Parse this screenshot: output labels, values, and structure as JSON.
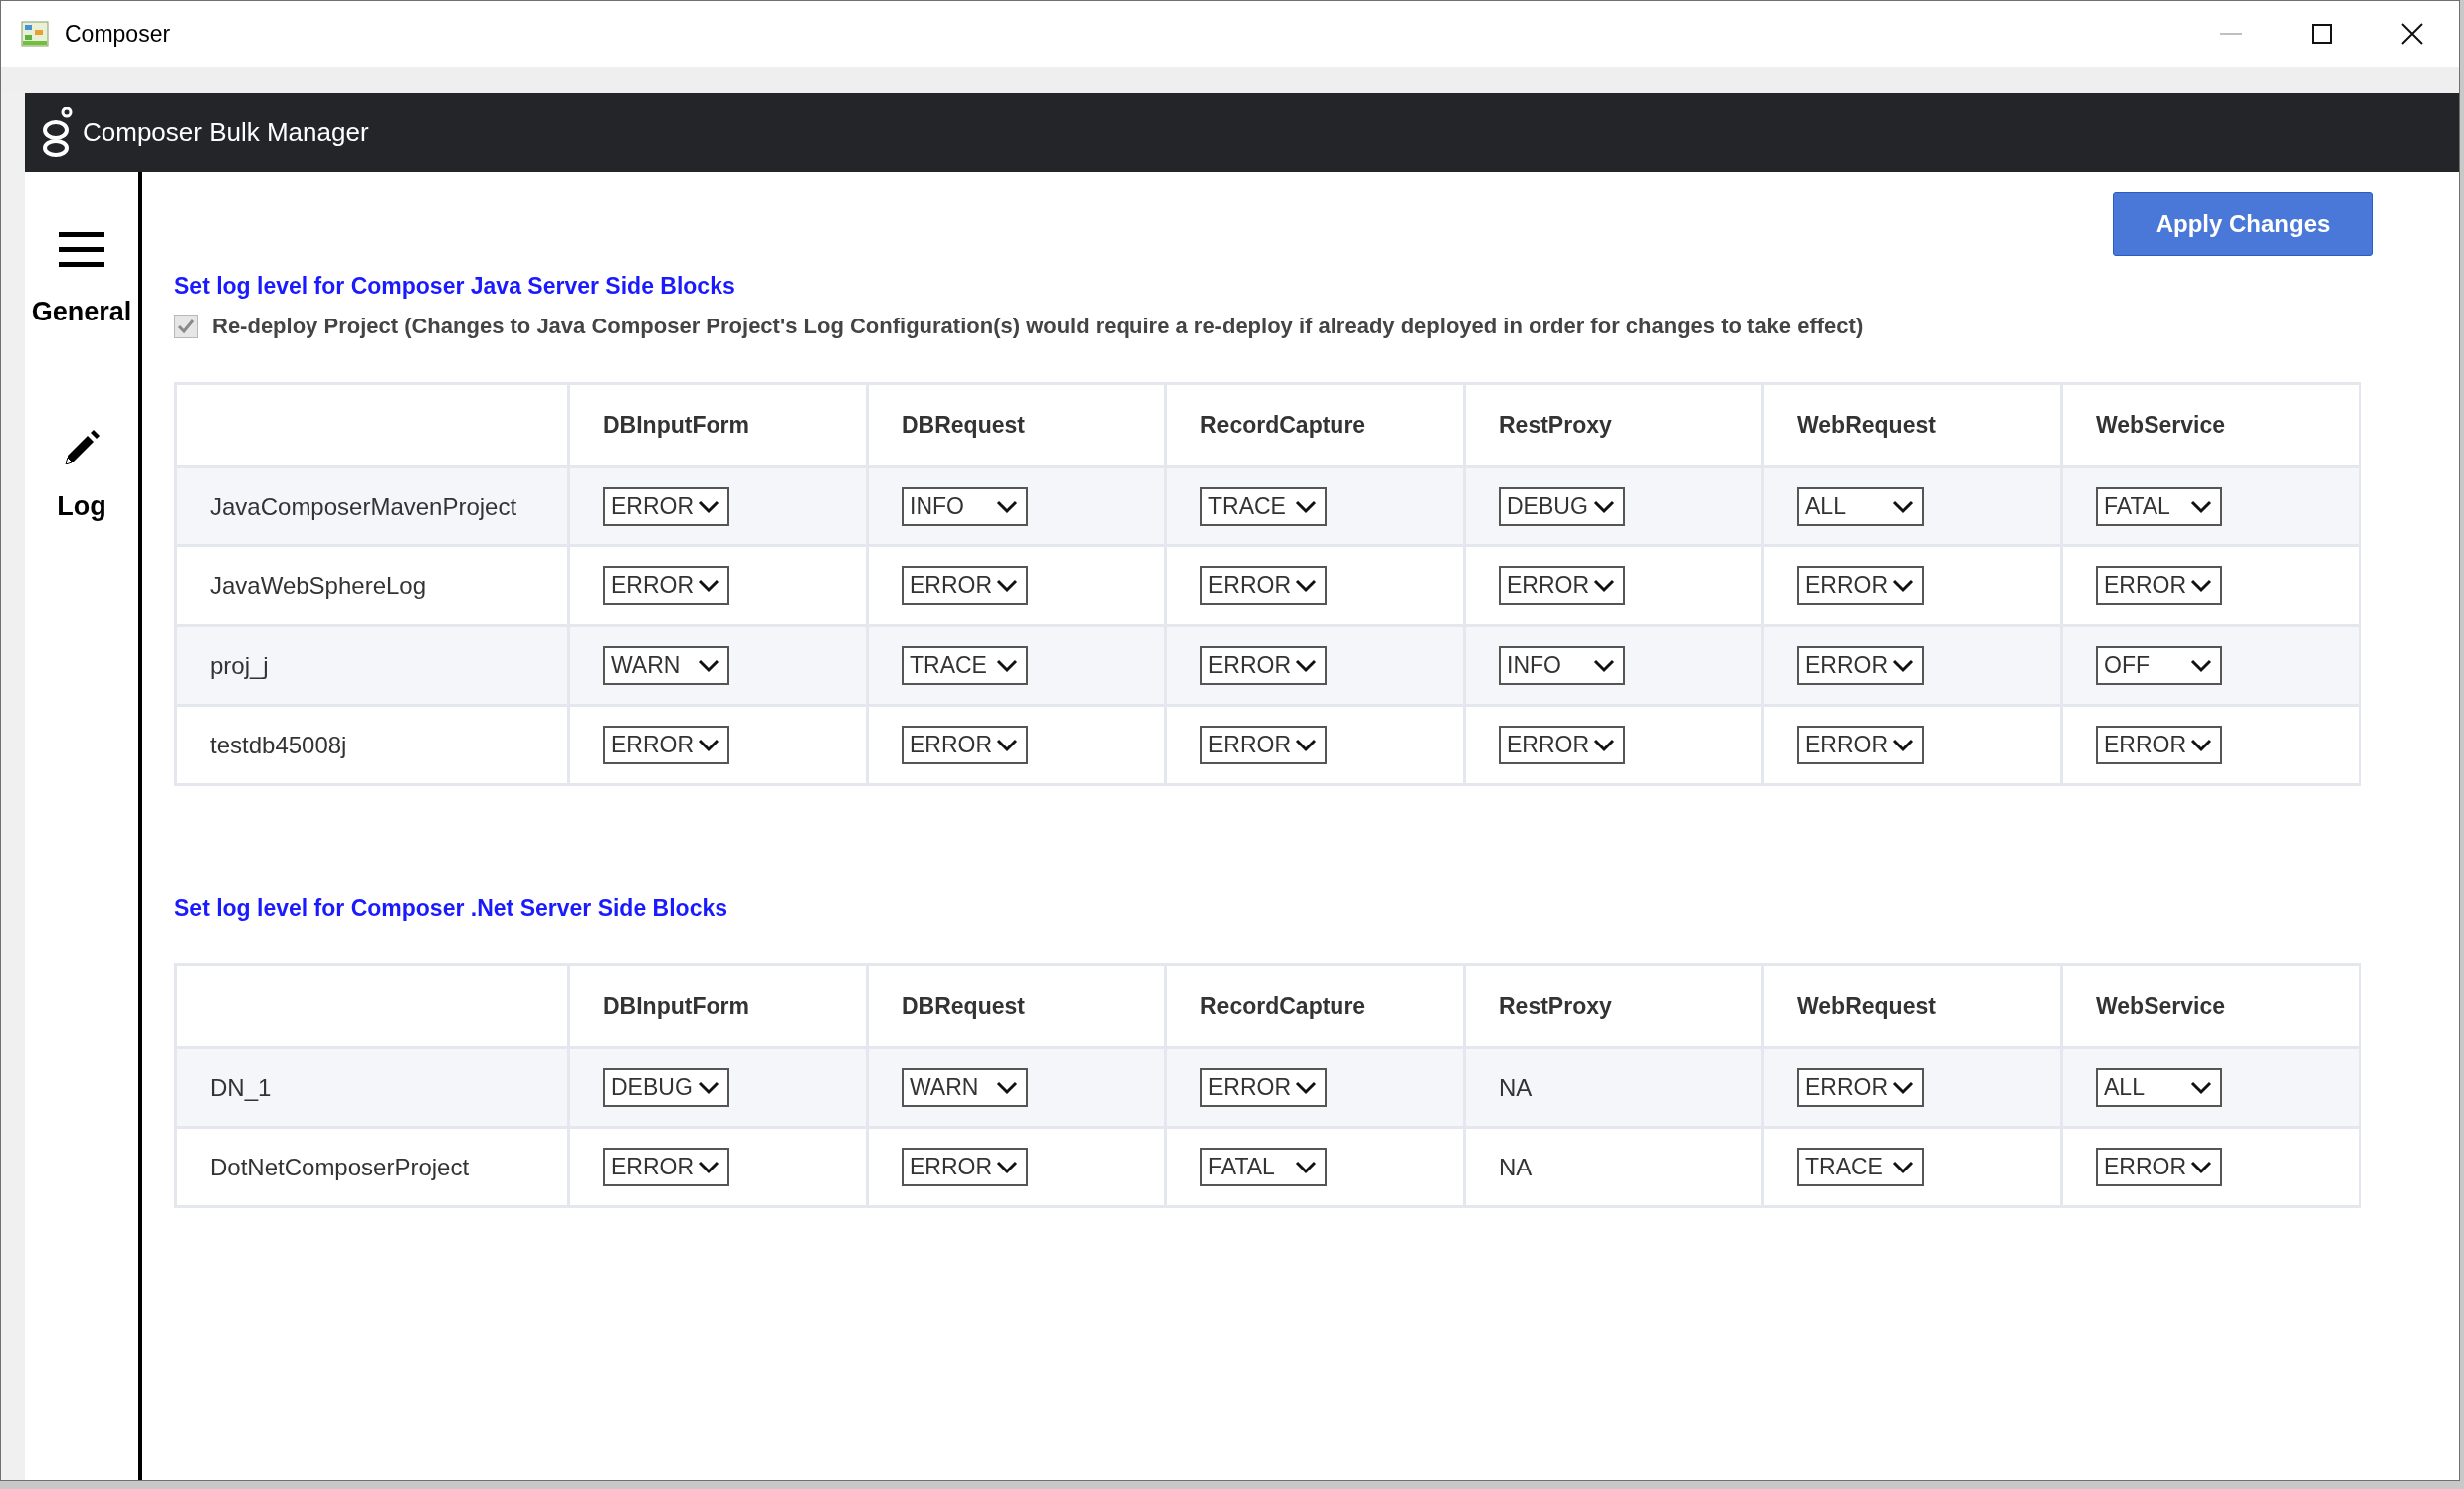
{
  "window": {
    "title": "Composer"
  },
  "app_header": {
    "title": "Composer Bulk Manager"
  },
  "sidebar": {
    "items": [
      {
        "kind": "menu",
        "label": "General"
      },
      {
        "kind": "pencil",
        "label": "Log"
      }
    ]
  },
  "apply_button": {
    "label": "Apply Changes"
  },
  "sections": [
    {
      "title": "Set log level for Composer Java Server Side Blocks",
      "checkbox": {
        "label": "Re-deploy Project (Changes to Java Composer Project's Log Configuration(s) would require a re-deploy if already deployed in order for changes to take effect)",
        "checked": true,
        "disabled": true
      },
      "table": {
        "columns": [
          "DBInputForm",
          "DBRequest",
          "RecordCapture",
          "RestProxy",
          "WebRequest",
          "WebService"
        ],
        "rows": [
          {
            "name": "JavaComposerMavenProject",
            "cells": [
              {
                "kind": "select",
                "value": "ERROR"
              },
              {
                "kind": "select",
                "value": "INFO"
              },
              {
                "kind": "select",
                "value": "TRACE"
              },
              {
                "kind": "select",
                "value": "DEBUG"
              },
              {
                "kind": "select",
                "value": "ALL"
              },
              {
                "kind": "select",
                "value": "FATAL"
              }
            ]
          },
          {
            "name": "JavaWebSphereLog",
            "cells": [
              {
                "kind": "select",
                "value": "ERROR"
              },
              {
                "kind": "select",
                "value": "ERROR"
              },
              {
                "kind": "select",
                "value": "ERROR"
              },
              {
                "kind": "select",
                "value": "ERROR"
              },
              {
                "kind": "select",
                "value": "ERROR"
              },
              {
                "kind": "select",
                "value": "ERROR"
              }
            ]
          },
          {
            "name": "proj_j",
            "cells": [
              {
                "kind": "select",
                "value": "WARN"
              },
              {
                "kind": "select",
                "value": "TRACE"
              },
              {
                "kind": "select",
                "value": "ERROR"
              },
              {
                "kind": "select",
                "value": "INFO"
              },
              {
                "kind": "select",
                "value": "ERROR"
              },
              {
                "kind": "select",
                "value": "OFF"
              }
            ]
          },
          {
            "name": "testdb45008j",
            "cells": [
              {
                "kind": "select",
                "value": "ERROR"
              },
              {
                "kind": "select",
                "value": "ERROR"
              },
              {
                "kind": "select",
                "value": "ERROR"
              },
              {
                "kind": "select",
                "value": "ERROR"
              },
              {
                "kind": "select",
                "value": "ERROR"
              },
              {
                "kind": "select",
                "value": "ERROR"
              }
            ]
          }
        ]
      }
    },
    {
      "title": "Set log level for Composer .Net Server Side Blocks",
      "table": {
        "columns": [
          "DBInputForm",
          "DBRequest",
          "RecordCapture",
          "RestProxy",
          "WebRequest",
          "WebService"
        ],
        "rows": [
          {
            "name": "DN_1",
            "cells": [
              {
                "kind": "select",
                "value": "DEBUG"
              },
              {
                "kind": "select",
                "value": "WARN"
              },
              {
                "kind": "select",
                "value": "ERROR"
              },
              {
                "kind": "text",
                "value": "NA"
              },
              {
                "kind": "select",
                "value": "ERROR"
              },
              {
                "kind": "select",
                "value": "ALL"
              }
            ]
          },
          {
            "name": "DotNetComposerProject",
            "cells": [
              {
                "kind": "select",
                "value": "ERROR"
              },
              {
                "kind": "select",
                "value": "ERROR"
              },
              {
                "kind": "select",
                "value": "FATAL"
              },
              {
                "kind": "text",
                "value": "NA"
              },
              {
                "kind": "select",
                "value": "TRACE"
              },
              {
                "kind": "select",
                "value": "ERROR"
              }
            ]
          }
        ]
      }
    }
  ]
}
